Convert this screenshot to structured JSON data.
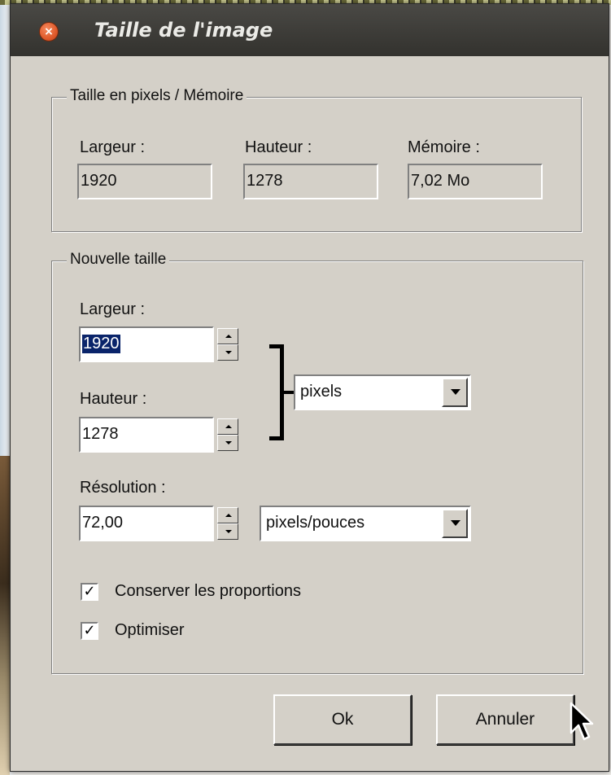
{
  "window": {
    "title": "Taille de l'image",
    "close_glyph": "×"
  },
  "pixels_group": {
    "legend": "Taille en pixels / Mémoire",
    "width_label": "Largeur :",
    "width_value": "1920",
    "height_label": "Hauteur :",
    "height_value": "1278",
    "memory_label": "Mémoire :",
    "memory_value": "7,02 Mo"
  },
  "new_size_group": {
    "legend": "Nouvelle taille",
    "width_label": "Largeur :",
    "width_value": "1920",
    "height_label": "Hauteur :",
    "height_value": "1278",
    "unit_selected": "pixels",
    "resolution_label": "Résolution :",
    "resolution_value": "72,00",
    "resolution_unit_selected": "pixels/pouces",
    "keep_proportions_label": "Conserver les proportions",
    "keep_proportions_checked": true,
    "optimize_label": "Optimiser",
    "optimize_checked": true
  },
  "buttons": {
    "ok_label": "Ok",
    "cancel_label": "Annuler"
  },
  "icons": {
    "close": "close-icon",
    "spin_up": "arrow-up-icon",
    "spin_down": "arrow-down-icon",
    "dropdown": "chevron-down-icon",
    "link": "link-bracket-icon",
    "cursor": "mouse-pointer-icon"
  },
  "colors": {
    "dialog_bg": "#d4d0c8",
    "titlebar_bg": "#3c3b37",
    "close_button": "#e05a2b",
    "selection": "#0a246a"
  }
}
